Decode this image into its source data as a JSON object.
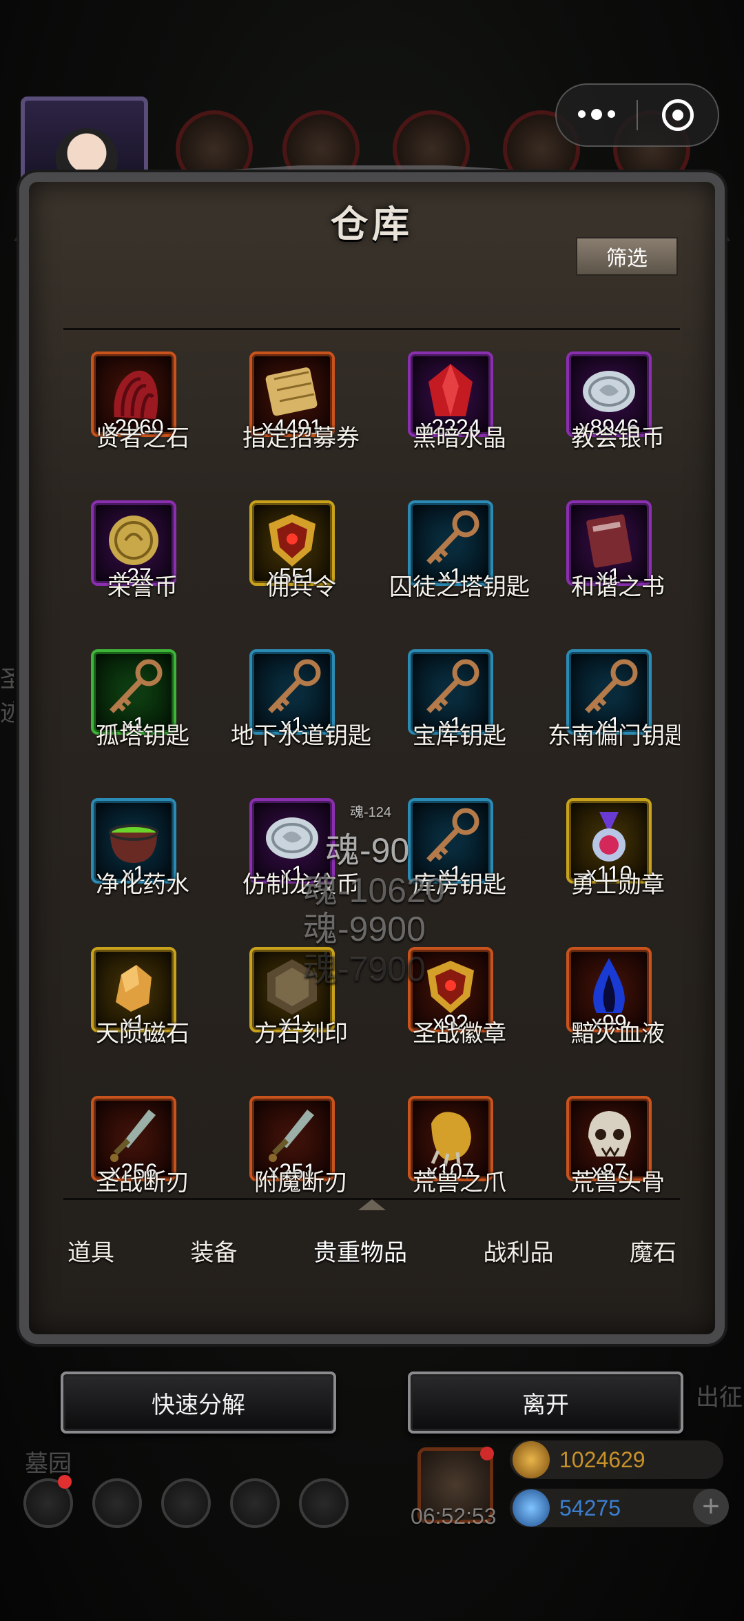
{
  "panel": {
    "title": "仓库",
    "filter_label": "筛选"
  },
  "items": [
    {
      "name": "贤者之石",
      "qty": "x2060",
      "frame": "red",
      "icon": "red-cloth-icon"
    },
    {
      "name": "指定招募券",
      "qty": "x4491",
      "frame": "red",
      "icon": "scroll-icon"
    },
    {
      "name": "黑暗水晶",
      "qty": "x2224",
      "frame": "purple",
      "icon": "red-crystal-icon"
    },
    {
      "name": "教会银币",
      "qty": "x8946",
      "frame": "purple",
      "icon": "silver-coin-icon"
    },
    {
      "name": "荣誉币",
      "qty": "x27",
      "frame": "purple",
      "icon": "gold-coin-icon"
    },
    {
      "name": "佣兵令",
      "qty": "x551",
      "frame": "gold",
      "icon": "shield-emblem-icon"
    },
    {
      "name": "囚徒之塔钥匙",
      "qty": "x1",
      "frame": "blue",
      "icon": "key-icon"
    },
    {
      "name": "和谐之书",
      "qty": "x1",
      "frame": "purple",
      "icon": "book-icon"
    },
    {
      "name": "孤塔钥匙",
      "qty": "x1",
      "frame": "green",
      "icon": "key-icon"
    },
    {
      "name": "地下水道钥匙",
      "qty": "x1",
      "frame": "blue",
      "icon": "key-icon"
    },
    {
      "name": "宝库钥匙",
      "qty": "x1",
      "frame": "blue",
      "icon": "key-icon"
    },
    {
      "name": "东南偏门钥匙",
      "qty": "x1",
      "frame": "blue",
      "icon": "key-icon"
    },
    {
      "name": "净化药水",
      "qty": "x1",
      "frame": "blue",
      "icon": "cauldron-icon"
    },
    {
      "name": "仿制龙纹币",
      "qty": "x1",
      "frame": "purple",
      "icon": "silver-coin-icon"
    },
    {
      "name": "库房钥匙",
      "qty": "x1",
      "frame": "blue",
      "icon": "key-icon"
    },
    {
      "name": "勇士勋章",
      "qty": "x110",
      "frame": "gold",
      "icon": "medal-icon"
    },
    {
      "name": "天陨磁石",
      "qty": "x1",
      "frame": "gold",
      "icon": "ore-icon"
    },
    {
      "name": "方石刻印",
      "qty": "x1",
      "frame": "gold",
      "icon": "stone-seal-icon"
    },
    {
      "name": "圣战徽章",
      "qty": "x92",
      "frame": "red",
      "icon": "shield-emblem-icon"
    },
    {
      "name": "黯灭血液",
      "qty": "x99",
      "frame": "red",
      "icon": "blue-flame-icon"
    },
    {
      "name": "圣战断刃",
      "qty": "x256",
      "frame": "red",
      "icon": "broken-blade-icon"
    },
    {
      "name": "附魔断刃",
      "qty": "x251",
      "frame": "red",
      "icon": "broken-blade-icon"
    },
    {
      "name": "荒兽之爪",
      "qty": "x107",
      "frame": "red",
      "icon": "claw-icon"
    },
    {
      "name": "荒兽头骨",
      "qty": "x87",
      "frame": "red",
      "icon": "skull-icon"
    }
  ],
  "floating_text": {
    "small": "魂-124",
    "line1": "魂-90",
    "line2": "魂-10620",
    "line3": "魂-9900",
    "line4": "魂-7900"
  },
  "tabs": [
    {
      "label": "道具"
    },
    {
      "label": "装备"
    },
    {
      "label": "贵重物品",
      "active": true
    },
    {
      "label": "战利品"
    },
    {
      "label": "魔石"
    }
  ],
  "buttons": {
    "quick_decompose": "快速分解",
    "leave": "离开"
  },
  "hud": {
    "left_label": "墓园",
    "right_label": "出征",
    "side_label": "圣迹",
    "timer": "06:52:53",
    "gold": "1024629",
    "gems": "54275"
  },
  "colors": {
    "frame_red": "#c9531c",
    "frame_purple": "#8a2fb0",
    "frame_gold": "#c9a21c",
    "frame_blue": "#2b8bb4",
    "frame_green": "#3fb43a",
    "gold_text": "#c8922a",
    "gem_text": "#3a7fd0"
  }
}
